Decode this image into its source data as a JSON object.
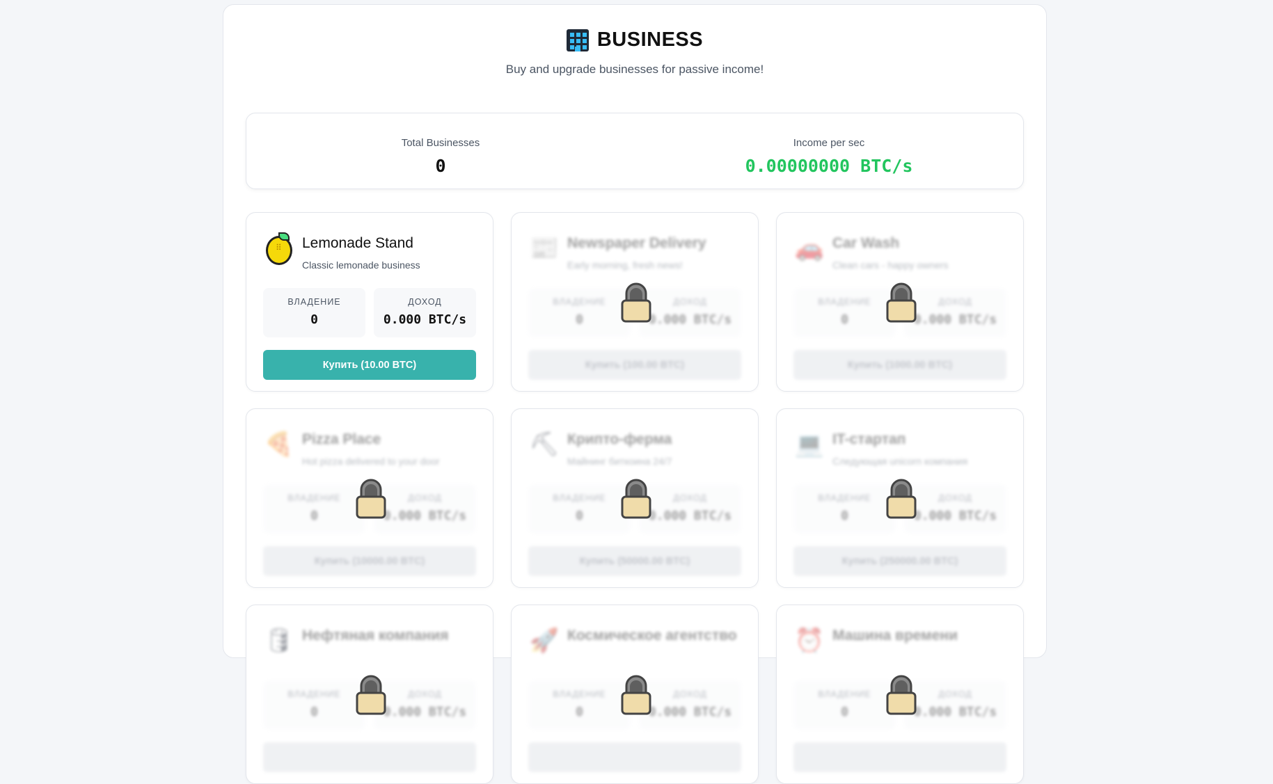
{
  "header": {
    "title": "BUSINESS",
    "subtitle": "Buy and upgrade businesses for passive income!",
    "icon": "office-building-icon"
  },
  "stats": {
    "total_label": "Total Businesses",
    "total_value": "0",
    "income_label": "Income per sec",
    "income_value": "0.00000000 BTC/s",
    "income_color": "#22c55e"
  },
  "colors": {
    "accent": "#38b2ac",
    "locked_button": "#d9dde3"
  },
  "businesses": [
    {
      "name": "Lemonade Stand",
      "desc": "Classic lemonade business",
      "icon": "lemon-icon",
      "own_label": "ВЛАДЕНИЕ",
      "own": "0",
      "income_label": "ДОХОД",
      "income": "0.000 BTC/s",
      "buy": "Купить (10.00 BTC)",
      "locked": false
    },
    {
      "name": "Newspaper Delivery",
      "desc": "Early morning, fresh news!",
      "icon": "newspaper-icon",
      "own_label": "ВЛАДЕНИЕ",
      "own": "0",
      "income_label": "ДОХОД",
      "income": "0.000 BTC/s",
      "buy": "Купить (100.00 BTC)",
      "locked": true
    },
    {
      "name": "Car Wash",
      "desc": "Clean cars - happy owners",
      "icon": "car-icon",
      "own_label": "ВЛАДЕНИЕ",
      "own": "0",
      "income_label": "ДОХОД",
      "income": "0.000 BTC/s",
      "buy": "Купить (1000.00 BTC)",
      "locked": true
    },
    {
      "name": "Pizza Place",
      "desc": "Hot pizza delivered to your door",
      "icon": "pizza-icon",
      "own_label": "ВЛАДЕНИЕ",
      "own": "0",
      "income_label": "ДОХОД",
      "income": "0.000 BTC/s",
      "buy": "Купить (10000.00 BTC)",
      "locked": true
    },
    {
      "name": "Крипто-ферма",
      "desc": "Майнинг биткоина 24/7",
      "icon": "pickaxe-icon",
      "own_label": "ВЛАДЕНИЕ",
      "own": "0",
      "income_label": "ДОХОД",
      "income": "0.000 BTC/s",
      "buy": "Купить (50000.00 BTC)",
      "locked": true
    },
    {
      "name": "IT-стартап",
      "desc": "Следующая unicorn компания",
      "icon": "laptop-icon",
      "own_label": "ВЛАДЕНИЕ",
      "own": "0",
      "income_label": "ДОХОД",
      "income": "0.000 BTC/s",
      "buy": "Купить (250000.00 BTC)",
      "locked": true
    },
    {
      "name": "Нефтяная компания",
      "desc": "",
      "icon": "oil-drum-icon",
      "own_label": "ВЛАДЕНИЕ",
      "own": "0",
      "income_label": "ДОХОД",
      "income": "0.000 BTC/s",
      "buy": "",
      "locked": true
    },
    {
      "name": "Космическое агентство",
      "desc": "",
      "icon": "rocket-icon",
      "own_label": "ВЛАДЕНИЕ",
      "own": "0",
      "income_label": "ДОХОД",
      "income": "0.000 BTC/s",
      "buy": "",
      "locked": true
    },
    {
      "name": "Машина времени",
      "desc": "",
      "icon": "alarm-clock-icon",
      "own_label": "ВЛАДЕНИЕ",
      "own": "0",
      "income_label": "ДОХОД",
      "income": "0.000 BTC/s",
      "buy": "",
      "locked": true
    }
  ]
}
